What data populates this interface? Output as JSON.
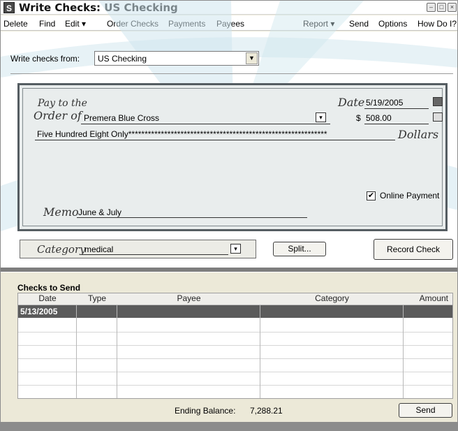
{
  "window": {
    "title": "Write Checks: US Checking"
  },
  "menu": {
    "delete": "Delete",
    "find": "Find",
    "edit": "Edit ▾",
    "order_checks": "Order Checks",
    "payments": "Payments",
    "payees": "Payees",
    "report": "Report ▾",
    "send": "Send",
    "options": "Options",
    "how_do_i": "How Do I?"
  },
  "from": {
    "label": "Write checks from:",
    "value": "US Checking"
  },
  "check": {
    "pay_to_line1": "Pay to the",
    "pay_to_line2": "Order of",
    "payee": "Premera Blue Cross",
    "date_label": "Date",
    "date": "5/19/2005",
    "dollar_sign": "$",
    "amount": "508.00",
    "amount_words": "Five Hundred Eight Only*************************************************************",
    "dollars_label": "Dollars",
    "online_payment_label": "Online Payment",
    "online_payment_checked": true,
    "memo_label": "Memo",
    "memo": "June & July"
  },
  "category": {
    "label": "Category",
    "value": "medical",
    "split_button": "Split...",
    "record_button": "Record Check"
  },
  "checks_to_send": {
    "title": "Checks to Send",
    "columns": [
      "Date",
      "Type",
      "Payee",
      "Category",
      "Amount"
    ],
    "rows": [
      {
        "date": "5/13/2005",
        "type": "",
        "payee": "",
        "category": "",
        "amount": ""
      }
    ],
    "ending_balance_label": "Ending Balance:",
    "ending_balance": "7,288.21",
    "send_button": "Send"
  },
  "colors": {
    "check_border": "#555d62",
    "check_fill": "#e9eded",
    "selected_row": "#5b5b5b",
    "watermark": "#c8e4ec"
  }
}
